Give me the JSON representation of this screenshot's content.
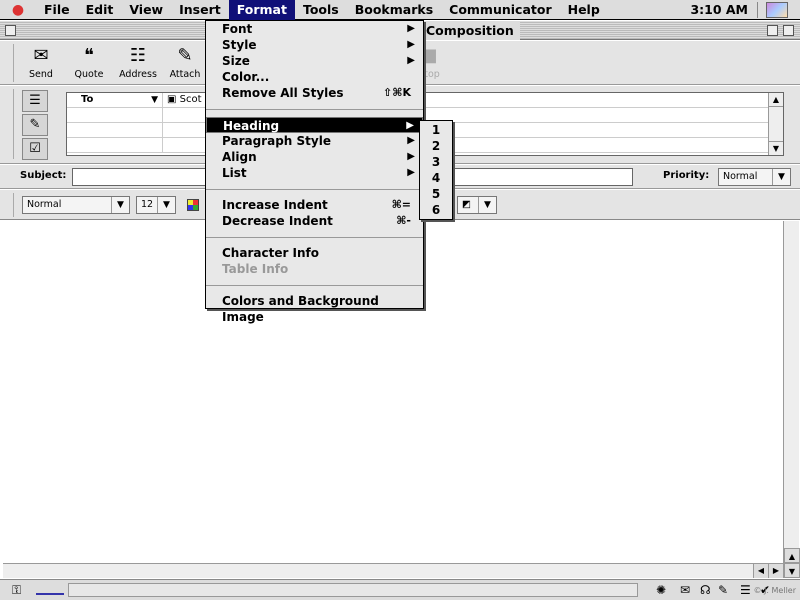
{
  "menubar": {
    "apple_icon": "apple-icon",
    "items": [
      "File",
      "Edit",
      "View",
      "Insert",
      "Format",
      "Tools",
      "Bookmarks",
      "Communicator",
      "Help"
    ],
    "active": "Format",
    "clock": "3:10 AM"
  },
  "window": {
    "title": "Composition"
  },
  "toolbar": {
    "send": "Send",
    "quote": "Quote",
    "address": "Address",
    "attach": "Attach",
    "stop": "Stop"
  },
  "address": {
    "to_label": "To",
    "recipient": "Scot"
  },
  "subject": {
    "label": "Subject:",
    "value": "",
    "priority_label": "Priority:",
    "priority_value": "Normal"
  },
  "format_toolbar": {
    "paragraph_style": "Normal",
    "font_size": "12"
  },
  "format_menu": {
    "items": [
      {
        "label": "Font",
        "submenu": true
      },
      {
        "label": "Style",
        "submenu": true
      },
      {
        "label": "Size",
        "submenu": true
      },
      {
        "label": "Color..."
      },
      {
        "label": "Remove All Styles",
        "shortcut": "⇧⌘K"
      },
      {
        "label": "Heading",
        "submenu": true,
        "selected": true
      },
      {
        "label": "Paragraph Style",
        "submenu": true
      },
      {
        "label": "Align",
        "submenu": true
      },
      {
        "label": "List",
        "submenu": true
      },
      {
        "label": "Increase Indent",
        "shortcut": "⌘="
      },
      {
        "label": "Decrease Indent",
        "shortcut": "⌘-"
      },
      {
        "label": "Character Info"
      },
      {
        "label": "Table Info",
        "disabled": true
      },
      {
        "label": "Colors and Background Image"
      }
    ]
  },
  "heading_submenu": {
    "items": [
      "1",
      "2",
      "3",
      "4",
      "5",
      "6"
    ]
  },
  "status": {
    "watermark": "© J. Meller"
  }
}
